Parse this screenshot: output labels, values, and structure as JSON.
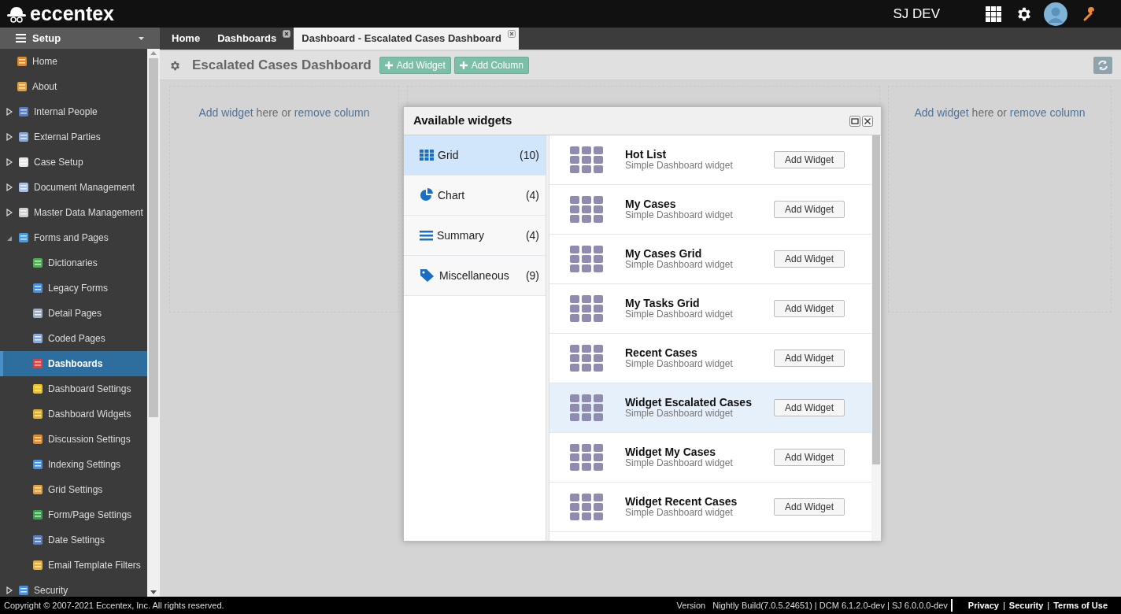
{
  "header": {
    "brand": "eccentex",
    "user": "SJ DEV"
  },
  "sidebar": {
    "title": "Setup",
    "items": [
      {
        "label": "Home",
        "kind": "leaf",
        "selected": false
      },
      {
        "label": "About",
        "kind": "leaf",
        "selected": false
      },
      {
        "label": "Internal People",
        "kind": "folder",
        "expanded": false,
        "selected": false
      },
      {
        "label": "External Parties",
        "kind": "folder",
        "expanded": false,
        "selected": false
      },
      {
        "label": "Case Setup",
        "kind": "folder",
        "expanded": false,
        "selected": false
      },
      {
        "label": "Document Management",
        "kind": "folder",
        "expanded": false,
        "selected": false
      },
      {
        "label": "Master Data Management",
        "kind": "folder",
        "expanded": false,
        "selected": false
      },
      {
        "label": "Forms and Pages",
        "kind": "folder",
        "expanded": true,
        "selected": false,
        "children": [
          {
            "label": "Dictionaries",
            "kind": "leaf",
            "selected": false
          },
          {
            "label": "Legacy Forms",
            "kind": "leaf",
            "selected": false
          },
          {
            "label": "Detail Pages",
            "kind": "leaf",
            "selected": false
          },
          {
            "label": "Coded Pages",
            "kind": "leaf",
            "selected": false
          },
          {
            "label": "Dashboards",
            "kind": "leaf",
            "selected": true
          },
          {
            "label": "Dashboard Settings",
            "kind": "leaf",
            "selected": false
          },
          {
            "label": "Dashboard Widgets",
            "kind": "leaf",
            "selected": false
          },
          {
            "label": "Discussion Settings",
            "kind": "leaf",
            "selected": false
          },
          {
            "label": "Indexing Settings",
            "kind": "leaf",
            "selected": false
          },
          {
            "label": "Grid Settings",
            "kind": "leaf",
            "selected": false
          },
          {
            "label": "Form/Page Settings",
            "kind": "leaf",
            "selected": false
          },
          {
            "label": "Date Settings",
            "kind": "leaf",
            "selected": false
          },
          {
            "label": "Email Template Filters",
            "kind": "leaf",
            "selected": false
          }
        ]
      },
      {
        "label": "Security",
        "kind": "folder",
        "expanded": false,
        "selected": false
      }
    ]
  },
  "tabs": [
    {
      "label": "Home",
      "selected": false,
      "closable": false
    },
    {
      "label": "Dashboards",
      "selected": false,
      "closable": true
    },
    {
      "label": "Dashboard - Escalated Cases Dashboard",
      "selected": true,
      "closable": true
    }
  ],
  "toolbar": {
    "title": "Escalated Cases Dashboard",
    "buttons": [
      "Add Widget",
      "Add Column"
    ]
  },
  "columns": [
    {
      "link1": "Add widget",
      "middle": " here or ",
      "link2": "remove column"
    },
    {},
    {
      "link1": "Add widget",
      "middle": " here or ",
      "link2": "remove column"
    }
  ],
  "dialog": {
    "title": "Available widgets",
    "categories": [
      {
        "label": "Grid",
        "count": "(10)",
        "selected": true
      },
      {
        "label": "Chart",
        "count": "(4)",
        "selected": false
      },
      {
        "label": "Summary",
        "count": "(4)",
        "selected": false
      },
      {
        "label": "Miscellaneous",
        "count": "(9)",
        "selected": false
      }
    ],
    "widgets": [
      {
        "name": "Hot List",
        "description": "Simple Dashboard widget",
        "button": "Add Widget",
        "selected": false
      },
      {
        "name": "My Cases",
        "description": "Simple Dashboard widget",
        "button": "Add Widget",
        "selected": false
      },
      {
        "name": "My Cases Grid",
        "description": "Simple Dashboard widget",
        "button": "Add Widget",
        "selected": false
      },
      {
        "name": "My Tasks Grid",
        "description": "Simple Dashboard widget",
        "button": "Add Widget",
        "selected": false
      },
      {
        "name": "Recent Cases",
        "description": "Simple Dashboard widget",
        "button": "Add Widget",
        "selected": false
      },
      {
        "name": "Widget Escalated Cases",
        "description": "Simple Dashboard widget",
        "button": "Add Widget",
        "selected": true
      },
      {
        "name": "Widget My Cases",
        "description": "Simple Dashboard widget",
        "button": "Add Widget",
        "selected": false
      },
      {
        "name": "Widget Recent Cases",
        "description": "Simple Dashboard widget",
        "button": "Add Widget",
        "selected": false
      }
    ]
  },
  "footer": {
    "copyright": "Copyright © 2007-2021 Eccentex, Inc. All rights reserved.",
    "version_label": "Version",
    "version": "Nightly Build(7.0.5.24651) | DCM 6.1.2.0-dev | SJ 6.0.0.0-dev",
    "links": [
      "Privacy",
      "Security",
      "Terms of Use"
    ],
    "separator": "|"
  }
}
